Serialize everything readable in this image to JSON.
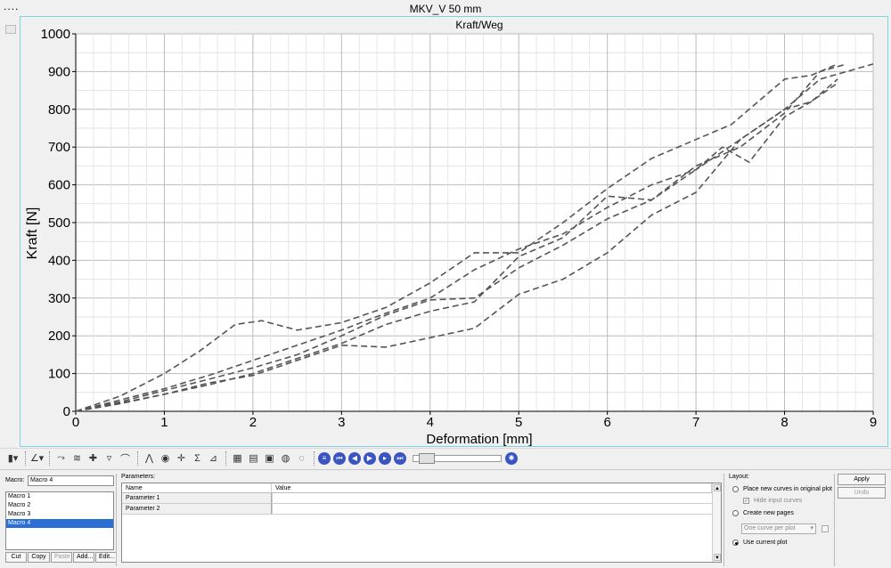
{
  "window": {
    "title": "MKV_V 50 mm",
    "dots": "...."
  },
  "chart_data": {
    "type": "line",
    "title": "Kraft/Weg",
    "xlabel": "Deformation [mm]",
    "ylabel": "Kraft [N]",
    "xlim": [
      0,
      9
    ],
    "ylim": [
      0,
      1000
    ],
    "xticks": [
      "0",
      "1",
      "2",
      "3",
      "4",
      "5",
      "6",
      "7",
      "8",
      "9"
    ],
    "yticks": [
      "0",
      "100",
      "200",
      "300",
      "400",
      "500",
      "600",
      "700",
      "800",
      "900",
      "1000"
    ],
    "grid": true,
    "line_style": "dashed",
    "line_color": "#555555",
    "series": [
      {
        "x": [
          0,
          0.5,
          1,
          1.4,
          1.8,
          2.1,
          2.5,
          3,
          3.5,
          4,
          4.5,
          5,
          5.5,
          6,
          6.5,
          7,
          7.4,
          7.8,
          8,
          8.3,
          8.6
        ],
        "y": [
          0,
          40,
          100,
          160,
          230,
          240,
          215,
          235,
          275,
          340,
          420,
          420,
          500,
          590,
          670,
          720,
          760,
          840,
          880,
          890,
          920
        ]
      },
      {
        "x": [
          0,
          0.5,
          1,
          1.5,
          2,
          2.5,
          3,
          3.5,
          4,
          4.5,
          5,
          5.5,
          6,
          6.5,
          7,
          7.5,
          8,
          8.4,
          8.7,
          9
        ],
        "y": [
          0,
          30,
          60,
          95,
          135,
          175,
          215,
          260,
          300,
          375,
          430,
          470,
          540,
          600,
          640,
          720,
          800,
          880,
          900,
          920
        ]
      },
      {
        "x": [
          0,
          0.5,
          1,
          1.5,
          2,
          2.5,
          3,
          3.5,
          4,
          4.5,
          5,
          5.5,
          6,
          6.5,
          7,
          7.5,
          8,
          8.4,
          8.7
        ],
        "y": [
          0,
          25,
          55,
          85,
          115,
          150,
          200,
          255,
          295,
          300,
          380,
          440,
          510,
          560,
          650,
          700,
          790,
          900,
          920
        ]
      },
      {
        "x": [
          0,
          0.5,
          1,
          1.5,
          2,
          2.5,
          3,
          3.5,
          4,
          4.5,
          5,
          5.5,
          6,
          6.5,
          7,
          7.3,
          7.6,
          8,
          8.3,
          8.6
        ],
        "y": [
          0,
          22,
          45,
          70,
          100,
          140,
          180,
          230,
          265,
          290,
          410,
          460,
          570,
          560,
          640,
          700,
          660,
          780,
          820,
          870
        ]
      },
      {
        "x": [
          0,
          0.5,
          1,
          1.5,
          2,
          2.5,
          3,
          3.5,
          4,
          4.5,
          5,
          5.5,
          6,
          6.5,
          7,
          7.5,
          8,
          8.3,
          8.6
        ],
        "y": [
          0,
          20,
          45,
          75,
          95,
          135,
          175,
          170,
          195,
          220,
          310,
          350,
          420,
          520,
          580,
          720,
          800,
          820,
          880
        ]
      }
    ]
  },
  "toolbar": {
    "icons": [
      "bar-chart-icon",
      "axis-icon",
      "curve-edit-icon",
      "curve-filter-icon",
      "add-curve-icon",
      "marker-icon",
      "cut-curve-icon",
      "peak-icon",
      "color-wheel-icon",
      "crosshair-icon",
      "sigma-icon",
      "slope-icon",
      "table-icon",
      "grid-icon",
      "report-icon",
      "comment-icon",
      "globe-icon",
      "menu-icon",
      "skip-back-icon",
      "step-back-icon",
      "play-icon",
      "step-forward-icon",
      "skip-forward-icon",
      "settings-icon"
    ]
  },
  "macro": {
    "label": "Macro:",
    "current": "Macro 4",
    "items": [
      "Macro 1",
      "Macro 2",
      "Macro 3",
      "Macro 4"
    ],
    "selected_index": 3,
    "buttons": {
      "cut": "Cut",
      "copy": "Copy",
      "paste": "Paste",
      "add": "Add...",
      "edit": "Edit..."
    }
  },
  "parameters": {
    "label": "Parameters:",
    "columns": [
      "Name",
      "Value"
    ],
    "rows": [
      {
        "name": "Parameter 1",
        "value": ""
      },
      {
        "name": "Parameter 2",
        "value": ""
      }
    ]
  },
  "layout": {
    "label": "Layout:",
    "opt_original": "Place new curves in original plot",
    "opt_hide": "Hide input curves",
    "opt_new_pages": "Create new pages",
    "select_value": "One curve per plot",
    "opt_current": "Use current plot",
    "selected": "current"
  },
  "actions": {
    "apply": "Apply",
    "undo": "Undo"
  }
}
